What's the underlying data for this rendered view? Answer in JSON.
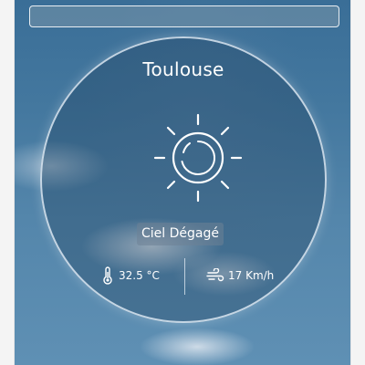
{
  "search": {
    "placeholder": "",
    "value": ""
  },
  "weather": {
    "city": "Toulouse",
    "condition": "Ciel Dégagé",
    "icon": "clear-sky-sun-icon",
    "temperature": "32.5 °C",
    "wind": "17 Km/h"
  },
  "colors": {
    "text": "#ffffff",
    "sky_top": "#3a6e97",
    "sky_bottom": "#5f90b4"
  }
}
